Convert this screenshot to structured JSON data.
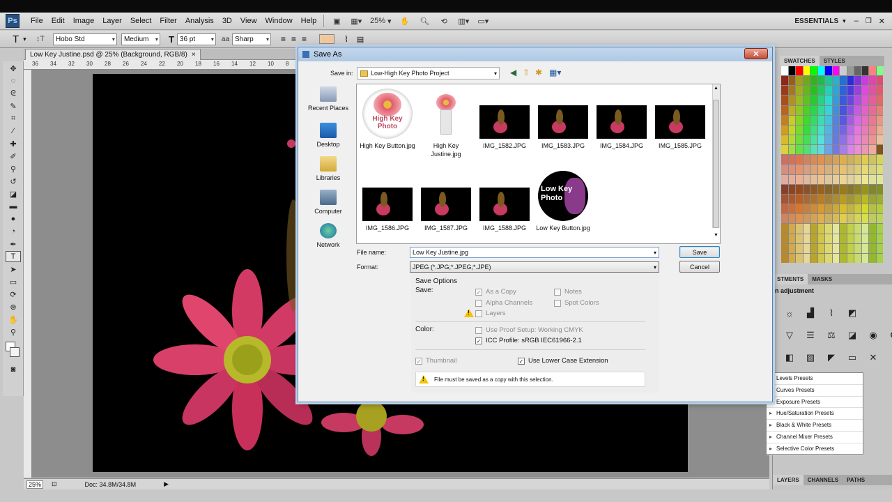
{
  "menubar": {
    "app_logo": "Ps",
    "items": [
      "File",
      "Edit",
      "Image",
      "Layer",
      "Select",
      "Filter",
      "Analysis",
      "3D",
      "View",
      "Window",
      "Help"
    ],
    "zoom": "25%",
    "workspace": "ESSENTIALS"
  },
  "options": {
    "font_family": "Hobo Std",
    "font_style": "Medium",
    "font_size": "36 pt",
    "antialias_icon_text": "aa",
    "antialias": "Sharp"
  },
  "document": {
    "tab_title": "Low Key Justine.psd @ 25% (Background, RGB/8)",
    "tab_close": "×",
    "ruler_ticks": [
      "36",
      "34",
      "32",
      "30",
      "28",
      "26",
      "24",
      "22",
      "20",
      "18",
      "16",
      "14",
      "12",
      "10",
      "8"
    ]
  },
  "status": {
    "zoom": "25%",
    "doc_info": "Doc: 34.8M/34.8M"
  },
  "right_panel": {
    "tabs": [
      "SWATCHES",
      "STYLES"
    ],
    "adjust_tabs": [
      "STMENTS",
      "MASKS"
    ],
    "adjust_hint": "n adjustment",
    "presets": [
      "Levels Presets",
      "Curves Presets",
      "Exposure Presets",
      "Hue/Saturation Presets",
      "Black & White Presets",
      "Channel Mixer Presets",
      "Selective Color Presets"
    ],
    "bottom_tabs": [
      "LAYERS",
      "CHANNELS",
      "PATHS"
    ]
  },
  "dialog": {
    "title": "Save As",
    "close": "✕",
    "save_in_label": "Save in:",
    "save_in_value": "Low-High Key Photo Project",
    "places": [
      "Recent Places",
      "Desktop",
      "Libraries",
      "Computer",
      "Network"
    ],
    "files": [
      {
        "name": "High Key Button.jpg",
        "thumb_text": "High Key Photo"
      },
      {
        "name": "High Key Justine.jpg"
      },
      {
        "name": "IMG_1582.JPG"
      },
      {
        "name": "IMG_1583.JPG"
      },
      {
        "name": "IMG_1584.JPG"
      },
      {
        "name": "IMG_1585.JPG"
      },
      {
        "name": "IMG_1586.JPG"
      },
      {
        "name": "IMG_1587.JPG"
      },
      {
        "name": "IMG_1588.JPG"
      },
      {
        "name": "Low Key Button.jpg",
        "thumb_text": "Low Key Photo"
      }
    ],
    "file_name_label": "File name:",
    "file_name_value": "Low Key Justine.jpg",
    "format_label": "Format:",
    "format_value": "JPEG (*.JPG;*.JPEG;*.JPE)",
    "save_button": "Save",
    "cancel_button": "Cancel",
    "save_options": {
      "heading": "Save Options",
      "save_label": "Save:",
      "as_a_copy": "As a Copy",
      "notes": "Notes",
      "alpha_channels": "Alpha Channels",
      "spot_colors": "Spot Colors",
      "layers": "Layers",
      "color_label": "Color:",
      "use_proof_setup": "Use Proof Setup:  Working CMYK",
      "icc_profile": "ICC Profile:  sRGB IEC61966-2.1",
      "thumbnail": "Thumbnail",
      "lower_case_ext": "Use Lower Case Extension",
      "warning": "File must be saved as a copy with this selection."
    }
  }
}
